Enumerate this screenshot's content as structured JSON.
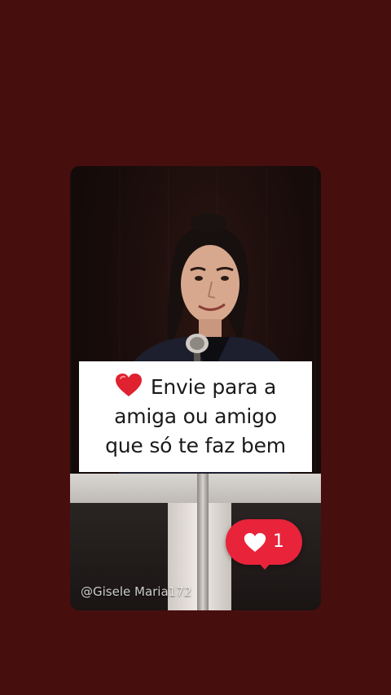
{
  "caption": {
    "line1": "Envie para a",
    "line2": "amiga ou amigo",
    "line3": "que só te faz bem",
    "emoji_icon": "red-heart-icon"
  },
  "like_badge": {
    "icon": "heart-icon",
    "count": "1"
  },
  "watermark": {
    "text": "@Gisele Maria172"
  },
  "colors": {
    "page_background": "#470e0e",
    "like_badge": "#e8233a",
    "caption_card": "#ffffff",
    "caption_text": "#1a1a1a"
  }
}
